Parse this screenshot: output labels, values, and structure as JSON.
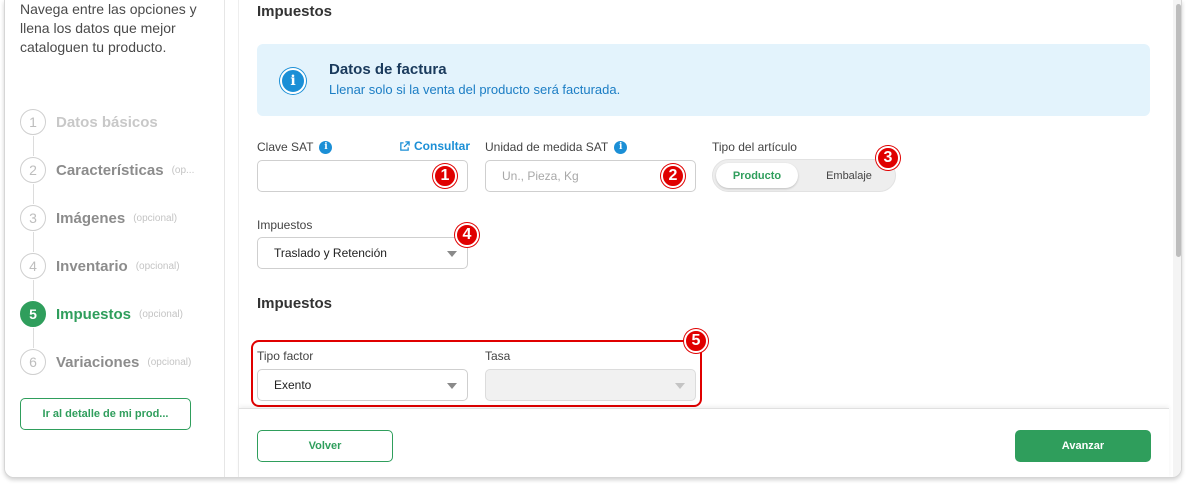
{
  "sidebar": {
    "intro": "Navega entre las opciones y llena los datos que mejor cataloguen tu producto.",
    "steps": [
      {
        "num": "1",
        "label": "Datos básicos",
        "optional": ""
      },
      {
        "num": "2",
        "label": "Características",
        "optional": "(op..."
      },
      {
        "num": "3",
        "label": "Imágenes",
        "optional": "(opcional)"
      },
      {
        "num": "4",
        "label": "Inventario",
        "optional": "(opcional)"
      },
      {
        "num": "5",
        "label": "Impuestos",
        "optional": "(opcional)"
      },
      {
        "num": "6",
        "label": "Variaciones",
        "optional": "(opcional)"
      }
    ],
    "detail_button": "Ir al detalle de mi prod..."
  },
  "main": {
    "section_title": "Impuestos",
    "info": {
      "icon": "info-icon",
      "title": "Datos de factura",
      "subtitle": "Llenar solo si la venta del producto será facturada."
    },
    "clave_sat": {
      "label": "Clave SAT",
      "consult": "Consultar",
      "value": ""
    },
    "unidad_sat": {
      "label": "Unidad de medida SAT",
      "placeholder": "Un., Pieza, Kg"
    },
    "tipo_articulo": {
      "label": "Tipo del artículo",
      "options": [
        "Producto",
        "Embalaje"
      ],
      "selected": "Producto"
    },
    "impuestos": {
      "label": "Impuestos",
      "value": "Traslado y Retención"
    },
    "subsection_title": "Impuestos",
    "tipo_factor": {
      "label": "Tipo factor",
      "value": "Exento"
    },
    "tasa": {
      "label": "Tasa",
      "value": ""
    }
  },
  "annotations": [
    "1",
    "2",
    "3",
    "4",
    "5"
  ],
  "footer": {
    "back": "Volver",
    "next": "Avanzar"
  },
  "colors": {
    "accent": "#2f9e5c",
    "info": "#1b8fd6",
    "annotation": "#e00000"
  }
}
